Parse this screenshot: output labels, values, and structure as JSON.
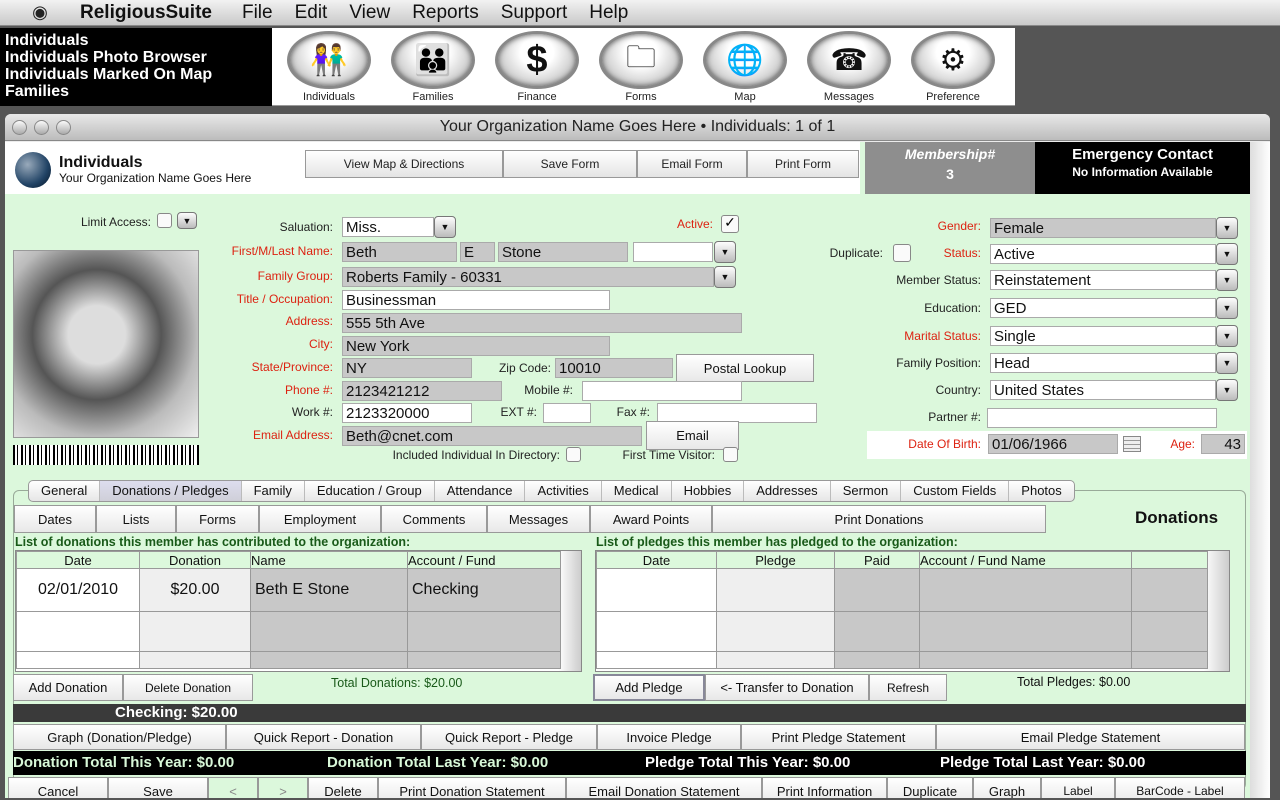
{
  "menubar": {
    "apple": "",
    "app": "ReligiousSuite",
    "items": [
      "File",
      "Edit",
      "View",
      "Reports",
      "Support",
      "Help"
    ]
  },
  "navlist": [
    "Individuals",
    "Individuals Photo Browser",
    "Individuals Marked On Map",
    "Families"
  ],
  "toolbar": [
    {
      "label": "Individuals",
      "glyph": "👫"
    },
    {
      "label": "Families",
      "glyph": "👪"
    },
    {
      "label": "Finance",
      "glyph": "$"
    },
    {
      "label": "Forms",
      "glyph": "🗀"
    },
    {
      "label": "Map",
      "glyph": "🌐"
    },
    {
      "label": "Messages",
      "glyph": "☎"
    },
    {
      "label": "Preference",
      "glyph": "⚙"
    }
  ],
  "window": {
    "title": "Your Organization Name Goes Here  •  Individuals: 1 of 1"
  },
  "header": {
    "title": "Individuals",
    "subtitle": "Your Organization Name Goes Here",
    "buttons": [
      "View Map & Directions",
      "Save Form",
      "Email Form",
      "Print Form"
    ],
    "membership_label": "Membership#",
    "membership_value": "3",
    "emergency_title": "Emergency Contact",
    "emergency_value": "No Information Available"
  },
  "form": {
    "limit_access": "Limit Access:",
    "salutation_label": "Saluation:",
    "salutation": "Miss.",
    "active_label": "Active:",
    "active": true,
    "name_label": "First/M/Last Name:",
    "first": "Beth",
    "middle": "E",
    "last": "Stone",
    "suffix": "",
    "family_label": "Family Group:",
    "family": "Roberts Family - 60331",
    "title_label": "Title / Occupation:",
    "title": "Businessman",
    "address_label": "Address:",
    "address": "555 5th Ave",
    "city_label": "City:",
    "city": "New York",
    "state_label": "State/Province:",
    "state": "NY",
    "zip_label": "Zip Code:",
    "zip": "10010",
    "postal_button": "Postal Lookup",
    "phone_label": "Phone #:",
    "phone": "2123421212",
    "mobile_label": "Mobile #:",
    "mobile": "",
    "work_label": "Work #:",
    "work": "2123320000",
    "ext_label": "EXT #:",
    "ext": "",
    "fax_label": "Fax #:",
    "fax": "",
    "email_label": "Email Address:",
    "email": "Beth@cnet.com",
    "email_button": "Email",
    "directory_label": "Included Individual In Directory:",
    "visitor_label": "First Time Visitor:",
    "gender_label": "Gender:",
    "gender": "Female",
    "duplicate_label": "Duplicate:",
    "status_label": "Status:",
    "status": "Active",
    "member_status_label": "Member Status:",
    "member_status": "Reinstatement",
    "education_label": "Education:",
    "education": "GED",
    "marital_label": "Marital Status:",
    "marital": "Single",
    "family_position_label": "Family Position:",
    "family_position": "Head",
    "country_label": "Country:",
    "country": "United States",
    "partner_label": "Partner #:",
    "partner": "",
    "dob_label": "Date Of Birth:",
    "dob": "01/06/1966",
    "age_label": "Age:",
    "age": "43"
  },
  "tabs": [
    "General",
    "Donations / Pledges",
    "Family",
    "Education / Group",
    "Attendance",
    "Activities",
    "Medical",
    "Hobbies",
    "Addresses",
    "Sermon",
    "Custom Fields",
    "Photos"
  ],
  "subtabs": [
    "Dates",
    "Lists",
    "Forms",
    "Employment",
    "Comments",
    "Messages",
    "Award Points",
    "Print Donations"
  ],
  "section_title": "Donations",
  "donations": {
    "caption": "List of donations this member has contributed to the organization:",
    "columns": [
      "Date",
      "Donation",
      "Name",
      "Account / Fund"
    ],
    "rows": [
      [
        "02/01/2010",
        "$20.00",
        "Beth E Stone",
        "Checking"
      ]
    ],
    "add": "Add Donation",
    "delete": "Delete Donation",
    "total": "Total Donations: $20.00"
  },
  "pledges": {
    "caption": "List of pledges this member has pledged to the organization:",
    "columns": [
      "Date",
      "Pledge",
      "Paid",
      "Account / Fund Name",
      ""
    ],
    "add": "Add Pledge",
    "transfer": "<- Transfer to Donation",
    "refresh": "Refresh",
    "total": "Total Pledges: $0.00"
  },
  "fund_summary": "Checking:   $20.00",
  "report_buttons": [
    "Graph (Donation/Pledge)",
    "Quick Report - Donation",
    "Quick Report - Pledge",
    "Invoice Pledge",
    "Print Pledge Statement",
    "Email Pledge Statement"
  ],
  "totals": {
    "don_this": "Donation Total This Year: $0.00",
    "don_last": "Donation Total Last Year: $0.00",
    "pl_this": "Pledge Total This Year: $0.00",
    "pl_last": "Pledge Total Last Year: $0.00"
  },
  "bottom_buttons": [
    "Cancel",
    "Save",
    "<",
    ">",
    "Delete",
    "Print Donation Statement",
    "Email Donation Statement",
    "Print Information",
    "Duplicate",
    "Graph",
    "Label",
    "BarCode - Label"
  ]
}
